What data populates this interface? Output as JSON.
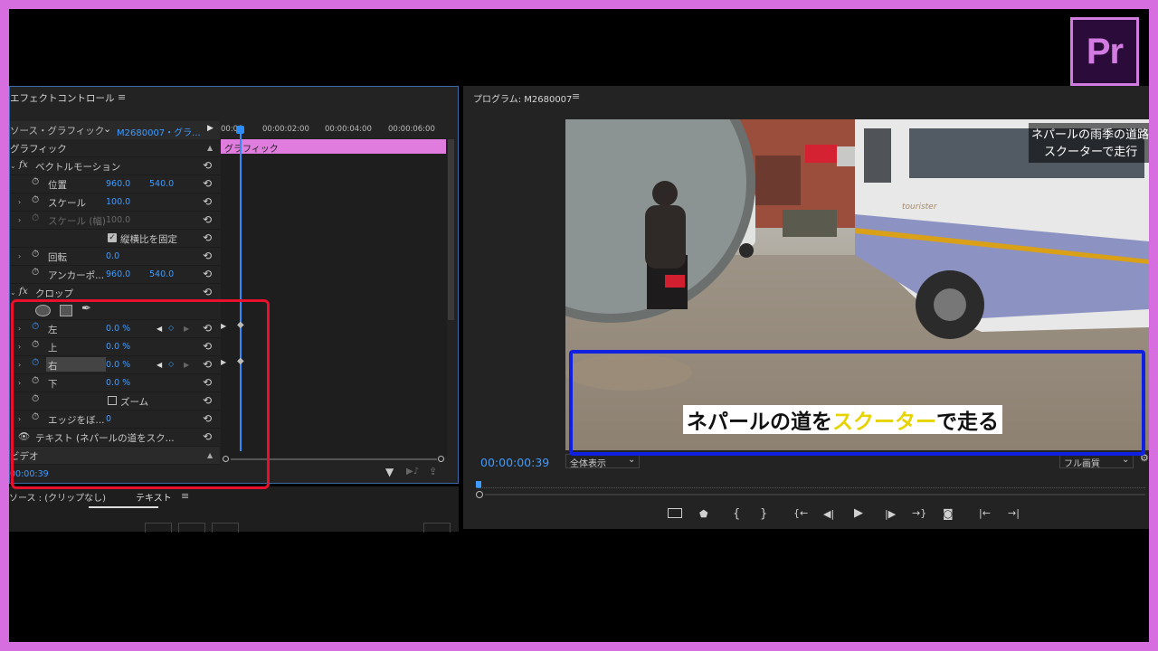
{
  "app_logo": "Pr",
  "effect_controls": {
    "title": "エフェクトコントロール",
    "menu_icon": "≡",
    "source_label": "ソース・グラフィック",
    "clip_label": "M2680007・グラ...",
    "timecodes": [
      "00:00",
      "00:00:02:00",
      "00:00:04:00",
      "00:00:06:00"
    ],
    "graphic_clip": "グラフィック",
    "section_graphic": "グラフィック",
    "vector_motion": "ベクトルモーション",
    "position_label": "位置",
    "position_x": "960.0",
    "position_y": "540.0",
    "scale_label": "スケール",
    "scale_value": "100.0",
    "scale_width_label": "スケール (幅)",
    "scale_width_value": "100.0",
    "uniform_scale": "縦横比を固定",
    "rotation_label": "回転",
    "rotation_value": "0.0",
    "anchor_label": "アンカーポ...",
    "anchor_x": "960.0",
    "anchor_y": "540.0",
    "crop": "クロップ",
    "left_label": "左",
    "left_value": "0.0 %",
    "top_label": "上",
    "top_value": "0.0 %",
    "right_label": "右",
    "right_value": "0.0 %",
    "bottom_label": "下",
    "bottom_value": "0.0 %",
    "zoom_label": "ズーム",
    "edge_label": "エッジをぼ...",
    "edge_value": "0",
    "text_layer": "テキスト (ネパールの道をスク...",
    "video_section": "ビデオ",
    "current_time": "00:00:39"
  },
  "bottom_panel": {
    "source_tab": "ソース : (クリップなし)",
    "text_tab": "テキスト",
    "menu_icon": "≡"
  },
  "program_monitor": {
    "title": "プログラム: M2680007",
    "menu_icon": "≡",
    "timecode": "00:00:00:39",
    "fit_dropdown": "全体表示",
    "quality_dropdown": "フル画質",
    "caption_top_line1": "ネパールの雨季の道路",
    "caption_top_line2": "スクーターで走行",
    "caption_main_part1": "ネパールの道を",
    "caption_main_highlight": "スクーター",
    "caption_main_part2": "で走る",
    "caption_highlight_color": "#e6d300",
    "bus_text": "tourister"
  },
  "annotations": {
    "red_box_color": "#e8102a",
    "blue_box_color": "#1020e0"
  }
}
